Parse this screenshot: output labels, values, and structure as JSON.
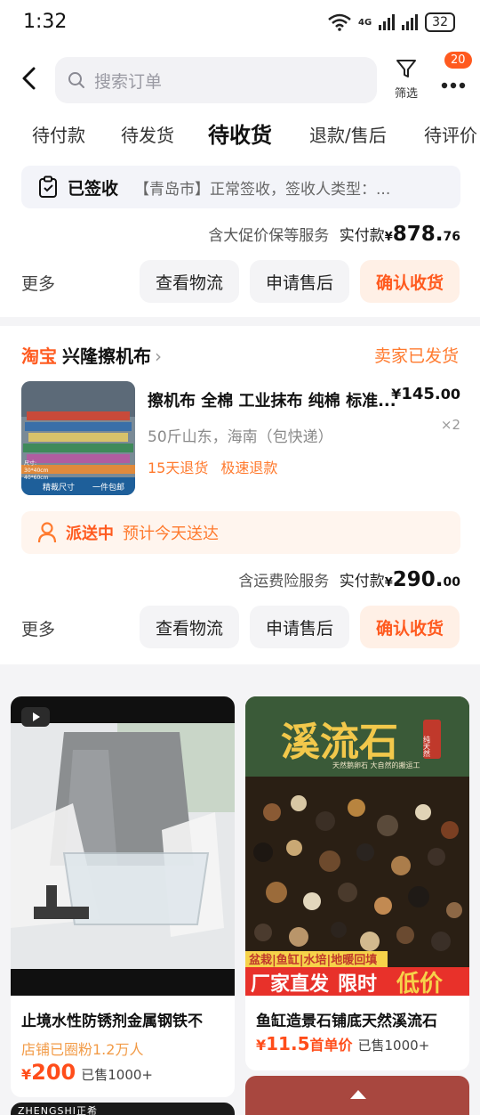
{
  "status": {
    "time": "1:32",
    "network": "4G",
    "battery": "32"
  },
  "header": {
    "search_placeholder": "搜索订单",
    "filter_label": "筛选",
    "badge": "20"
  },
  "tabs": [
    "待付款",
    "待发货",
    "待收货",
    "退款/售后",
    "待评价"
  ],
  "order1": {
    "signed_label": "已签收",
    "signed_detail": "【青岛市】正常签收，签收人类型：...",
    "service": "含大促价保等服务",
    "paid_label": "实付款",
    "yen": "¥",
    "amount_int": "878.",
    "amount_dec": "76",
    "more": "更多",
    "btn_logistics": "查看物流",
    "btn_aftersale": "申请售后",
    "btn_confirm": "确认收货"
  },
  "order2": {
    "brand": "淘宝",
    "shop_name": "兴隆擦机布",
    "shop_arrow": "›",
    "seller_status": "卖家已发货",
    "product_title": "擦机布 全棉 工业抹布 纯棉 标准...",
    "price_yen": "¥",
    "price_int": "145.",
    "price_dec": "00",
    "sku": "50斤山东，海南（包快递）",
    "qty": "×2",
    "tags": [
      "15天退货",
      "极速退款"
    ],
    "thumb_caption_left": "精裁尺寸",
    "thumb_caption_right": "一件包邮",
    "thumb_size_label": "尺寸:",
    "thumb_size_1": "30*40cm",
    "thumb_size_2": "40*60cm",
    "delivery_status": "派送中",
    "delivery_eta": "预计今天送达",
    "service": "含运费险服务",
    "paid_label": "实付款",
    "yen": "¥",
    "amount_int": "290.",
    "amount_dec": "00",
    "more": "更多",
    "btn_logistics": "查看物流",
    "btn_aftersale": "申请售后",
    "btn_confirm": "确认收货"
  },
  "recommend": [
    {
      "title": "止境水性防锈剂金属钢铁不",
      "sub": "店铺已圈粉1.2万人",
      "price_yen": "¥",
      "price": "200",
      "sold": "已售1000+"
    },
    {
      "title": "鱼缸造景石铺底天然溪流石",
      "sub": "",
      "price_yen": "¥",
      "price": "11.5",
      "price_suffix": "首单价",
      "sold": "已售1000+",
      "banner_title": "溪流石",
      "banner_seal": "纯天然",
      "banner_sub": "天然鹅卵石 大自然的搬运工",
      "banner_tags": "盆栽|鱼缸|水培|地暖回填",
      "banner_cta_1": "厂家直发",
      "banner_cta_2": "限时",
      "banner_cta_3": "低价"
    }
  ],
  "bottom_card_text": "ZHENGSHI正希"
}
